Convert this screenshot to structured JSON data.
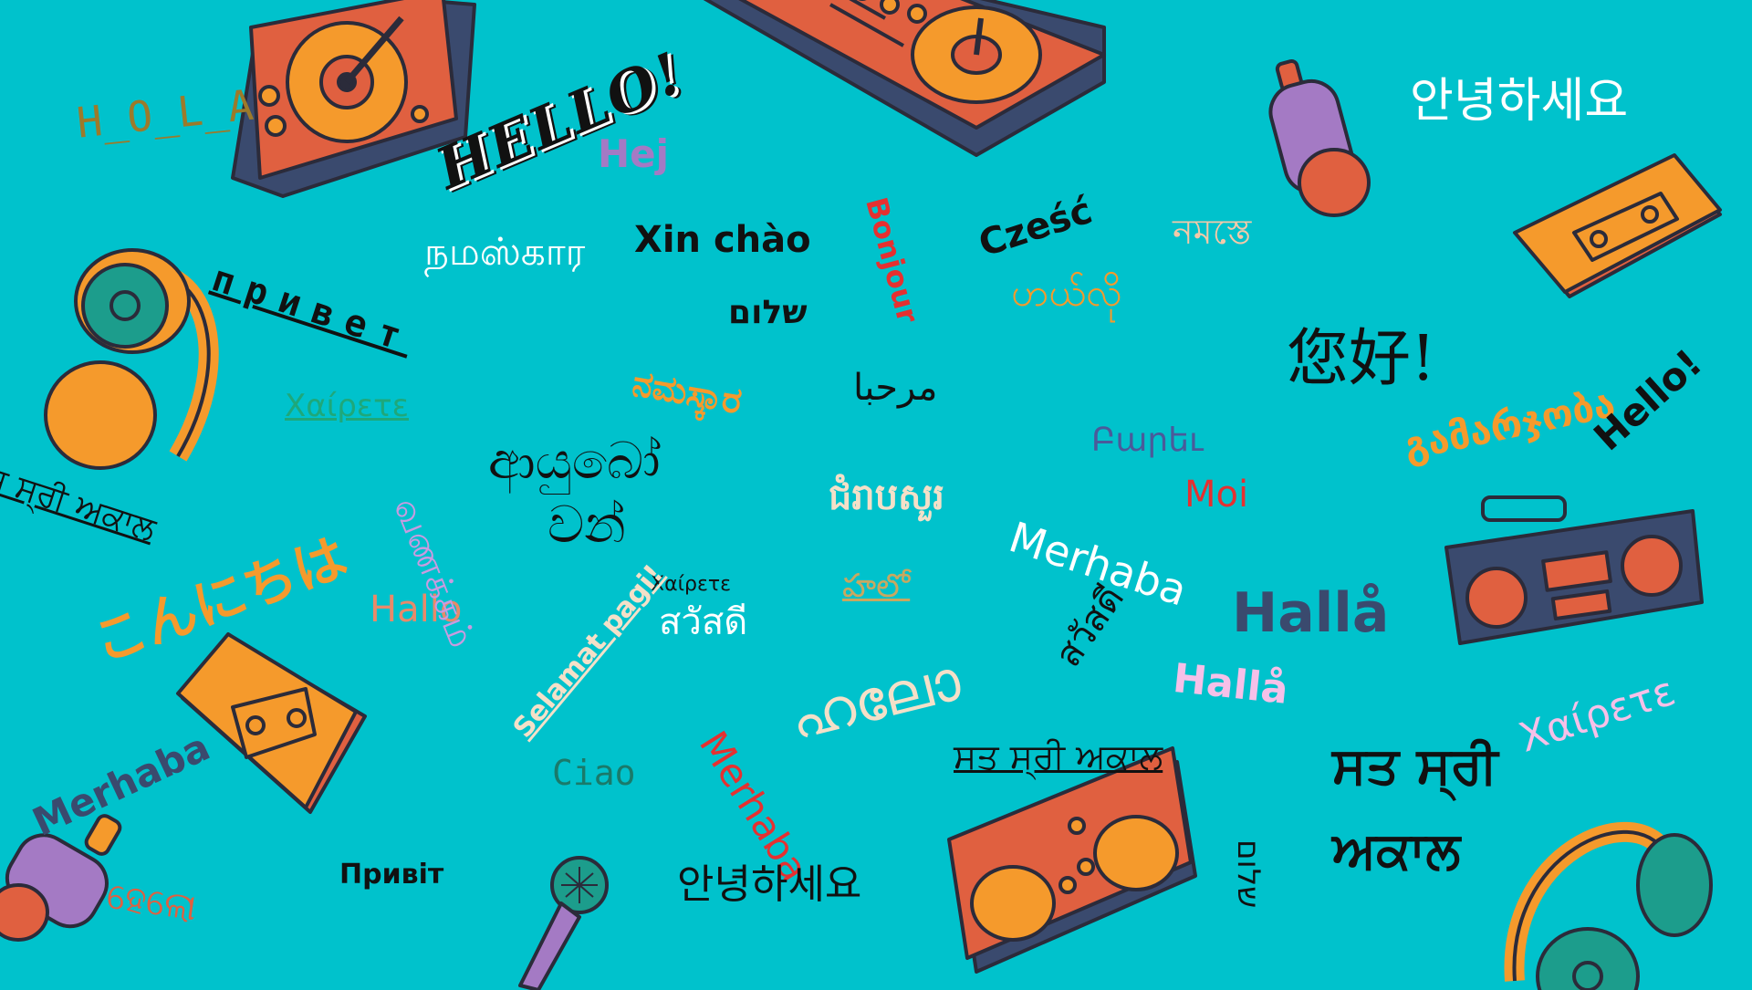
{
  "words": {
    "hola": "H_O_L_A",
    "hello_bold": "HELLO!",
    "hej": "Hej",
    "privet": "привет",
    "chaireta_green": "Χαίρετε",
    "sat_sri_left": "ਸ ਸ੍ਰੀ ਅਕਾਲ",
    "konnichiwa": "こんにちは",
    "namaskara_tamil": "நமஸ்கார",
    "xin_chao": "Xin chào",
    "bonjour": "Bonjour",
    "shalom": "שלום",
    "namaskara_kannada": "ನಮಸ್ಕಾರ",
    "marhaba_ar": "مرحبا",
    "ayubowan_1": "ආයුබෝ",
    "ayubowan_2": "වන්",
    "czesc": "Cześć",
    "namaste": "নমস্তে",
    "mingalaba": "ဟယ်လို",
    "nin_hao": "您好!",
    "barev": "Բարեւ",
    "moi": "Moi",
    "gamarjoba": "გამარჯობა",
    "hello_script": "Hello!",
    "chumreap": "ជំរាបសួរ",
    "hallo_salmon": "Hallo",
    "vanakkam": "வணக்கம்",
    "chaireta_small": "Χαίρετε",
    "selamat_pagi": "Selamat pagi!",
    "sawasdee_white": "สวัสดี",
    "telugu": "హలో",
    "malayalam": "ഹലോ",
    "merhaba_white": "Merhaba",
    "sawasdee_black": "สวัสดี",
    "halla_dark": "Hallå",
    "halla_pink": "Hallå",
    "chaireta_pink": "Χαίρετε",
    "merhaba_left": "Merhaba",
    "ciao": "Ciao",
    "merhaba_red": "Merhaba",
    "sat_sri_underlined": "ਸਤ ਸ੍ਰੀ ਅਕਾਲ",
    "sat_sri_big_1": "ਸਤ ਸ੍ਰੀ",
    "sat_sri_big_2": "ਅਕਾਲ",
    "pryvit": "Привіт",
    "annyeong_black": "안녕하세요",
    "annyeong_white": "안녕하세요",
    "shalom_vertical": "שלום",
    "halo_odia": "ହେଲୋ"
  },
  "colors": {
    "background": "#00c2cc",
    "orange": "#f59a2c",
    "red_orange": "#e06040",
    "navy": "#3a4a6e",
    "purple": "#a47ac4"
  },
  "icons": [
    "turntable-icon",
    "dj-mixer-icon",
    "headphones-icon",
    "cassette-icon",
    "boombox-icon",
    "microphone-icon",
    "spray-can-icon"
  ]
}
